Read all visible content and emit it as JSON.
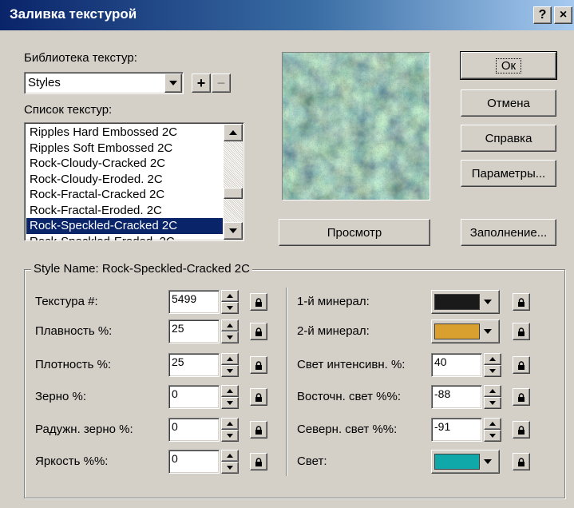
{
  "window": {
    "title": "Заливка текстурой",
    "help_button": "?",
    "close_button": "×"
  },
  "library": {
    "label": "Библиотека текстур:",
    "selected": "Styles",
    "add": "+",
    "remove": "−"
  },
  "texture_list": {
    "label": "Список текстур:",
    "items": [
      "Ripples Hard Embossed 2C",
      "Ripples Soft Embossed 2C",
      "Rock-Cloudy-Cracked 2C",
      "Rock-Cloudy-Eroded. 2C",
      "Rock-Fractal-Cracked 2C",
      "Rock-Fractal-Eroded. 2C",
      "Rock-Speckled-Cracked 2C",
      "Rock-Speckled-Eroded. 2C"
    ],
    "selected_index": 6
  },
  "buttons": {
    "ok": "Ок",
    "cancel": "Отмена",
    "help": "Справка",
    "options": "Параметры...",
    "preview": "Просмотр",
    "fill": "Заполнение..."
  },
  "style_group": {
    "title": "Style Name: Rock-Speckled-Cracked 2C",
    "left_params": [
      {
        "label": "Текстура #:",
        "value": "5499"
      },
      {
        "label": "Плавность %:",
        "value": "25"
      },
      {
        "label": "Плотность %:",
        "value": "25"
      },
      {
        "label": "Зерно %:",
        "value": "0"
      },
      {
        "label": "Радужн. зерно %:",
        "value": "0"
      },
      {
        "label": "Яркость %%:",
        "value": "0"
      }
    ],
    "right_params": [
      {
        "label": "1-й минерал:",
        "type": "color",
        "color": "#1a1a1a"
      },
      {
        "label": "2-й минерал:",
        "type": "color",
        "color": "#d9a030"
      },
      {
        "label": "Свет интенсивн. %:",
        "type": "spin",
        "value": "40"
      },
      {
        "label": "Восточн. свет %%:",
        "type": "spin",
        "value": "-88"
      },
      {
        "label": "Северн. свет %%:",
        "type": "spin",
        "value": "-91"
      },
      {
        "label": "Свет:",
        "type": "color",
        "color": "#10a8a8"
      }
    ]
  }
}
